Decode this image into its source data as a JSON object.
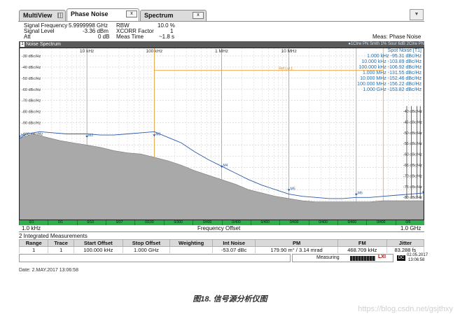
{
  "tabs": [
    {
      "label": "MultiView"
    },
    {
      "label": "Phase Noise"
    },
    {
      "label": "Spectrum"
    }
  ],
  "tab_close_glyph": "x",
  "window_button_glyph": "▼",
  "header": {
    "signal_frequency_label": "Signal Frequency",
    "signal_frequency_value": "5.9999998 GHz",
    "signal_level_label": "Signal Level",
    "signal_level_value": "-3.36 dBm",
    "att_label": "Att",
    "att_value": "0 dB",
    "rbw_label": "RBW",
    "rbw_value": "10.0 %",
    "xcorr_label": "XCORR Factor",
    "xcorr_value": "1",
    "meas_time_label": "Meas Time",
    "meas_time_value": "~1.8 s",
    "meas_mode": "Meas: Phase Noise"
  },
  "window": {
    "badge": "1",
    "title": "Noise Spectrum",
    "trace_info": "●1Clrw PN Smth 1% Sour 6dB 2Clrw PN"
  },
  "chart_data": {
    "type": "line",
    "title": "Noise Spectrum",
    "x_scale": "log",
    "x_range": [
      "1.0 kHz",
      "1.0 GHz"
    ],
    "top_tick_labels": [
      "10 kHz",
      "100 kHz",
      "1 MHz",
      "10 MHz"
    ],
    "y_tick_labels": [
      "-30 dBc/Hz",
      "-40 dBc/Hz",
      "-50 dBc/Hz",
      "-60 dBc/Hz",
      "-70 dBc/Hz",
      "-80 dBc/Hz",
      "-90 dBc/Hz",
      "-100 dBc/Hz",
      "-110 dBc/Hz",
      "-120 dBc/Hz",
      "-130 dBc/Hz",
      "-140 dBc/Hz",
      "-150 dBc/Hz",
      "-160 dBc/Hz",
      "-170 dBc/Hz"
    ],
    "y_right_tick_labels": [
      "-40 dBc/Hz",
      "-45 dBc/Hz",
      "-50 dBc/Hz",
      "-55 dBc/Hz",
      "-60 dBc/Hz",
      "-65 dBc/Hz",
      "-70 dBc/Hz",
      "-75 dBc/Hz",
      "-80 dBc/Hz",
      "-85 dBc/Hz",
      "-90 dBc/Hz"
    ],
    "ylim": [
      -175,
      -25
    ],
    "xlim_decades": [
      3,
      9
    ],
    "reference_line_label": "Ref Lvl 1",
    "series": [
      {
        "name": "1",
        "color": "#2b5aa8",
        "points": [
          [
            3.0,
            -104
          ],
          [
            3.1,
            -100
          ],
          [
            3.2,
            -99
          ],
          [
            3.3,
            -98
          ],
          [
            3.5,
            -99
          ],
          [
            3.7,
            -100
          ],
          [
            3.9,
            -100
          ],
          [
            4.0,
            -100
          ],
          [
            4.2,
            -101
          ],
          [
            4.4,
            -101
          ],
          [
            4.6,
            -100
          ],
          [
            4.8,
            -99
          ],
          [
            5.0,
            -98
          ],
          [
            5.2,
            -103
          ],
          [
            5.4,
            -108
          ],
          [
            5.6,
            -116
          ],
          [
            5.8,
            -123
          ],
          [
            6.0,
            -129
          ],
          [
            6.2,
            -135
          ],
          [
            6.4,
            -141
          ],
          [
            6.6,
            -146
          ],
          [
            6.8,
            -150
          ],
          [
            7.0,
            -154
          ],
          [
            7.2,
            -156
          ],
          [
            7.4,
            -157
          ],
          [
            7.6,
            -158
          ],
          [
            7.8,
            -158
          ],
          [
            8.0,
            -157
          ],
          [
            8.2,
            -157
          ],
          [
            8.4,
            -156
          ],
          [
            8.6,
            -155
          ],
          [
            8.8,
            -154
          ],
          [
            9.0,
            -153
          ]
        ]
      },
      {
        "name": "2",
        "color": "#9a9a9a",
        "points": [
          [
            3.0,
            -104
          ],
          [
            3.2,
            -100
          ],
          [
            3.4,
            -103
          ],
          [
            3.6,
            -106
          ],
          [
            3.8,
            -108
          ],
          [
            4.0,
            -110
          ],
          [
            4.2,
            -112
          ],
          [
            4.4,
            -115
          ],
          [
            4.6,
            -117
          ],
          [
            4.8,
            -118
          ],
          [
            5.0,
            -121
          ],
          [
            5.2,
            -124
          ],
          [
            5.4,
            -128
          ],
          [
            5.6,
            -133
          ],
          [
            5.8,
            -137
          ],
          [
            6.0,
            -141
          ],
          [
            6.2,
            -145
          ],
          [
            6.4,
            -150
          ],
          [
            6.6,
            -153
          ],
          [
            6.8,
            -156
          ],
          [
            7.0,
            -158
          ],
          [
            7.2,
            -160
          ],
          [
            7.4,
            -161
          ],
          [
            7.6,
            -161
          ],
          [
            7.8,
            -161
          ],
          [
            8.0,
            -161
          ],
          [
            8.2,
            -161
          ],
          [
            8.4,
            -160
          ],
          [
            8.6,
            -160
          ],
          [
            8.8,
            -160
          ],
          [
            9.0,
            -160
          ]
        ]
      }
    ],
    "markers": [
      {
        "label": "M1",
        "x": 3.0,
        "y": -104
      },
      {
        "label": "M2",
        "x": 4.0,
        "y": -104
      },
      {
        "label": "M3",
        "x": 5.0,
        "y": -103
      },
      {
        "label": "M4",
        "x": 6.0,
        "y": -131
      },
      {
        "label": "M5",
        "x": 7.0,
        "y": -152
      },
      {
        "label": "M6",
        "x": 8.0,
        "y": -156
      },
      {
        "label": "M7",
        "x": 9.0,
        "y": -154
      }
    ]
  },
  "spot_noise": {
    "title": "Spot Noise [T1]",
    "rows": [
      "1.000 kHz   -95.31 dBc/Hz",
      "10.000 kHz  -103.89 dBc/Hz",
      "100.000 kHz -106.92 dBc/Hz",
      "1.000 MHz   -131.55 dBc/Hz",
      "10.000 MHz  -152.46 dBc/Hz",
      "100.000 MHz -156.22 dBc/Hz",
      "1.000 GHz   -153.82 dBc/Hz"
    ]
  },
  "range_bar": {
    "labels": [
      "0/1",
      "0/1",
      "0/10",
      "0/37",
      "0/100",
      "0/300",
      "0/400",
      "0/400",
      "0/400",
      "0/400",
      "0/400",
      "0/400",
      "0/400",
      "0/6"
    ]
  },
  "axis_footer": {
    "start": "1.0 kHz",
    "center": "Frequency Offset",
    "stop": "1.0 GHz"
  },
  "integrated": {
    "title": "2 Integrated Measurements",
    "columns": [
      "Range",
      "Trace",
      "Start Offset",
      "Stop Offset",
      "Weighting",
      "Int Noise",
      "PM",
      "FM",
      "Jitter"
    ],
    "rows": [
      [
        "1",
        "1",
        "100.000 kHz",
        "1.000 GHz",
        "",
        "-53.07 dBc",
        "179.90 m° / 3.14 mrad",
        "468.709 kHz",
        "83.288 fs"
      ]
    ]
  },
  "status": {
    "measuring_label": "Measuring",
    "lxi_label": "LXI",
    "date": "02.05.2017",
    "time": "13:06:58"
  },
  "footer_date": "Date: 2.MAY.2017  13:06:58",
  "caption": "图18. 信号源分析仪图",
  "watermark": "https://blog.csdn.net/gsjthxy"
}
